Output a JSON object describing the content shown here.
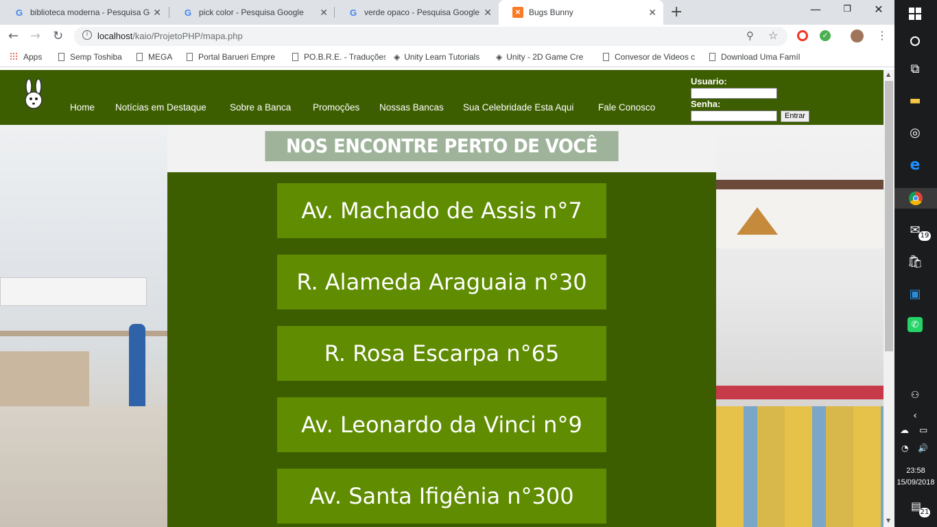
{
  "browser": {
    "tabs": [
      {
        "title": "biblioteca moderna - Pesquisa Go",
        "icon": "google-icon"
      },
      {
        "title": "pick color - Pesquisa Google",
        "icon": "google-icon"
      },
      {
        "title": "verde opaco - Pesquisa Google",
        "icon": "google-icon"
      },
      {
        "title": "Bugs Bunny",
        "icon": "xampp-icon",
        "active": true
      }
    ],
    "url_host": "localhost",
    "url_path": "/kaio/ProjetoPHP/mapa.php",
    "bookmarks": [
      "Apps",
      "Semp Toshiba",
      "MEGA",
      "Portal Barueri Empre",
      "PO.B.R.E. - Traduções",
      "Unity Learn Tutorials",
      "Unity - 2D Game Cre",
      "Convesor de Videos c",
      "Download Uma Famíl"
    ]
  },
  "site": {
    "nav": [
      "Home",
      "Notícias em Destaque",
      "Sobre a Banca",
      "Promoções",
      "Nossas Bancas",
      "Sua Celebridade Esta Aqui",
      "Fale Conosco"
    ],
    "login": {
      "user_label": "Usuario:",
      "pass_label": "Senha:",
      "submit": "Entrar"
    },
    "heading": "NOS ENCONTRE PERTO DE VOCÊ",
    "locations": [
      "Av. Machado de Assis n°7",
      "R. Alameda Araguaia n°30",
      "R. Rosa Escarpa n°65",
      "Av. Leonardo da Vinci n°9",
      "Av. Santa Ifigênia n°300"
    ],
    "colors": {
      "header": "#3d5e00",
      "button": "#5f8c00",
      "heading_bg": "#9fb39b"
    }
  },
  "taskbar": {
    "time": "23:58",
    "date": "15/09/2018",
    "mail_badge": "19",
    "notif_badge": "21"
  }
}
